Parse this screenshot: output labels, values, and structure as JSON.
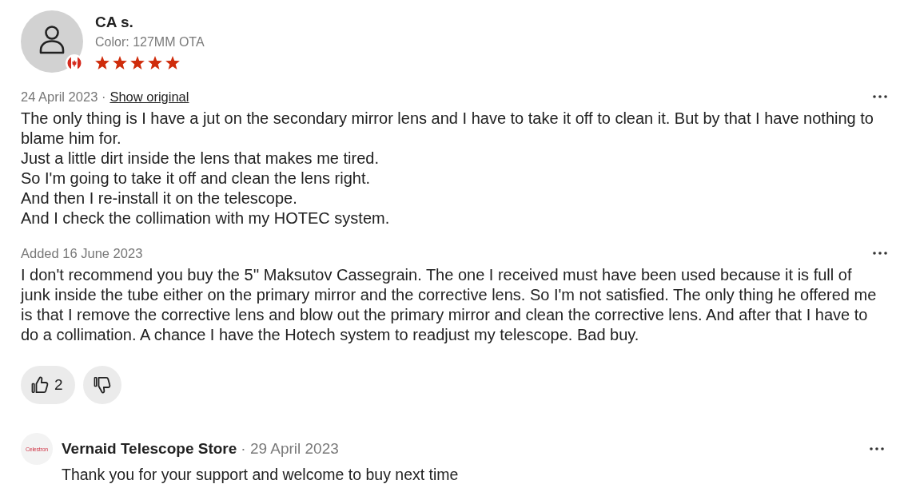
{
  "review": {
    "author": "CA s.",
    "variant": "Color: 127MM OTA",
    "stars": 5,
    "date": "24 April 2023 ·",
    "show_original": "Show original",
    "text": "The only thing is I have a jut on the secondary mirror lens and I have to take it off to clean it. But by that I have nothing to blame him for.\nJust a little dirt inside the lens that makes me tired.\nSo I'm going to take it off and clean the lens right.\nAnd then I re-install it on the telescope.\nAnd I check the collimation with my HOTEC system.",
    "follow_up": {
      "label": "Added 16 June 2023",
      "text": "I don't recommend you buy the 5'' Maksutov Cassegrain. The one I received must have been used because it is full of junk inside the tube either on the primary mirror and the corrective lens. So I'm not satisfied. The only thing he offered me is that I remove the corrective lens and blow out the primary mirror and clean the corrective lens. And after that I have to do a collimation. A chance I have the Hotech system to readjust my telescope. Bad buy."
    },
    "helpful_count": "2"
  },
  "reply": {
    "logo": "Celestron",
    "store": "Vernaid Telescope Store",
    "date": "· 29 April 2023",
    "text": "Thank you for your support and welcome to buy next time"
  }
}
